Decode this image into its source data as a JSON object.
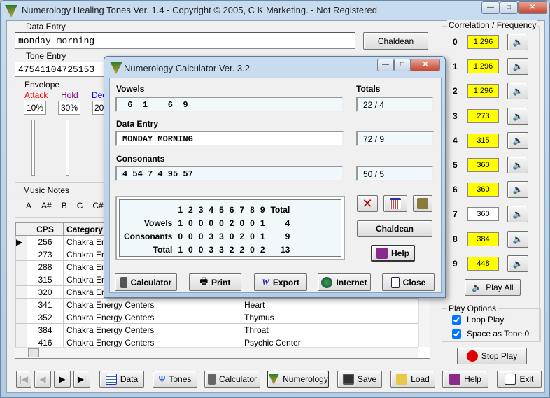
{
  "app": {
    "title": "Numerology Healing Tones Ver. 1.4 - Copyright © 2005, C K Marketing.  - Not Registered"
  },
  "data_entry": {
    "label": "Data Entry",
    "value": "monday morning",
    "chaldean": "Chaldean"
  },
  "tone_entry": {
    "label": "Tone Entry",
    "value": "47541104725153"
  },
  "envelope": {
    "label": "Envelope",
    "attack": {
      "label": "Attack",
      "value": "10%",
      "color": "#ff0000"
    },
    "hold": {
      "label": "Hold",
      "value": "30%",
      "color": "#800080"
    },
    "decay": {
      "label": "Dec",
      "value": "20",
      "color": "#0000ff"
    }
  },
  "music_notes": {
    "label": "Music Notes",
    "notes": [
      "A",
      "A#",
      "B",
      "C",
      "C#"
    ]
  },
  "table": {
    "headers": [
      "CPS",
      "Category",
      ""
    ],
    "rows": [
      [
        "256",
        "Chakra Energy Centers",
        ""
      ],
      [
        "273",
        "Chakra Energy Centers",
        ""
      ],
      [
        "288",
        "Chakra Energy Centers",
        ""
      ],
      [
        "315",
        "Chakra Energy Centers",
        ""
      ],
      [
        "320",
        "Chakra Energy Centers",
        ""
      ],
      [
        "341",
        "Chakra Energy Centers",
        "Heart"
      ],
      [
        "352",
        "Chakra Energy Centers",
        "Thymus"
      ],
      [
        "384",
        "Chakra Energy Centers",
        "Throat"
      ],
      [
        "416",
        "Chakra Energy Centers",
        "Psychic Center"
      ]
    ]
  },
  "correlation": {
    "label": "Correlation /  Frequency",
    "rows": [
      {
        "n": "0",
        "f": "1,296",
        "hl": true
      },
      {
        "n": "1",
        "f": "1,296",
        "hl": true
      },
      {
        "n": "2",
        "f": "1,296",
        "hl": true
      },
      {
        "n": "3",
        "f": "273",
        "hl": true
      },
      {
        "n": "4",
        "f": "315",
        "hl": true
      },
      {
        "n": "5",
        "f": "360",
        "hl": true
      },
      {
        "n": "6",
        "f": "360",
        "hl": true
      },
      {
        "n": "7",
        "f": "360",
        "hl": false
      },
      {
        "n": "8",
        "f": "384",
        "hl": true
      },
      {
        "n": "9",
        "f": "448",
        "hl": true
      }
    ],
    "play_all": "Play All",
    "highlight_color": "#ffff00"
  },
  "play_options": {
    "label": "Play Options",
    "loop": {
      "label": "Loop Play",
      "checked": true
    },
    "space": {
      "label": "Space as Tone 0",
      "checked": true
    }
  },
  "stop_play": "Stop Play",
  "toolbar": {
    "data": "Data",
    "tones": "Tones",
    "calculator": "Calculator",
    "numerology": "Numerology",
    "save": "Save",
    "load": "Load",
    "help": "Help",
    "exit": "Exit"
  },
  "dialog": {
    "title": "Numerology Calculator Ver. 3.2",
    "vowels_label": "Vowels",
    "vowels": " 6  1    6  9",
    "totals_label": "Totals",
    "vowels_total": "22 / 4",
    "data_label": "Data Entry",
    "data": "MONDAY MORNING",
    "data_total": "72 / 9",
    "cons_label": "Consonants",
    "cons": "4 54 7 4 95 57",
    "cons_total": "50 / 5",
    "grid": {
      "header": [
        "",
        "1",
        "2",
        "3",
        "4",
        "5",
        "6",
        "7",
        "8",
        "9",
        "Total"
      ],
      "rows": [
        [
          "Vowels",
          "1",
          "0",
          "0",
          "0",
          "0",
          "2",
          "0",
          "0",
          "1",
          "4"
        ],
        [
          "Consonants",
          "0",
          "0",
          "0",
          "3",
          "3",
          "0",
          "2",
          "0",
          "1",
          "9"
        ],
        [
          "Total",
          "1",
          "0",
          "0",
          "3",
          "3",
          "2",
          "2",
          "0",
          "2",
          "13"
        ]
      ]
    },
    "chaldean": "Chaldean",
    "help": "Help",
    "calculator": "Calculator",
    "print": "Print",
    "export": "Export",
    "internet": "Internet",
    "close": "Close"
  }
}
